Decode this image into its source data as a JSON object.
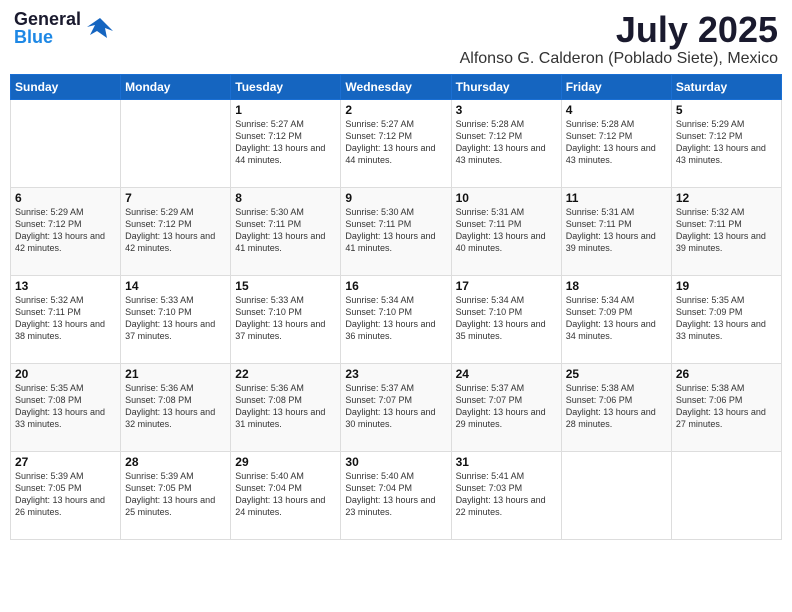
{
  "header": {
    "logo_general": "General",
    "logo_blue": "Blue",
    "main_title": "July 2025",
    "sub_title": "Alfonso G. Calderon (Poblado Siete), Mexico"
  },
  "weekdays": [
    "Sunday",
    "Monday",
    "Tuesday",
    "Wednesday",
    "Thursday",
    "Friday",
    "Saturday"
  ],
  "weeks": [
    [
      {
        "day": "",
        "info": ""
      },
      {
        "day": "",
        "info": ""
      },
      {
        "day": "1",
        "info": "Sunrise: 5:27 AM\nSunset: 7:12 PM\nDaylight: 13 hours and 44 minutes."
      },
      {
        "day": "2",
        "info": "Sunrise: 5:27 AM\nSunset: 7:12 PM\nDaylight: 13 hours and 44 minutes."
      },
      {
        "day": "3",
        "info": "Sunrise: 5:28 AM\nSunset: 7:12 PM\nDaylight: 13 hours and 43 minutes."
      },
      {
        "day": "4",
        "info": "Sunrise: 5:28 AM\nSunset: 7:12 PM\nDaylight: 13 hours and 43 minutes."
      },
      {
        "day": "5",
        "info": "Sunrise: 5:29 AM\nSunset: 7:12 PM\nDaylight: 13 hours and 43 minutes."
      }
    ],
    [
      {
        "day": "6",
        "info": "Sunrise: 5:29 AM\nSunset: 7:12 PM\nDaylight: 13 hours and 42 minutes."
      },
      {
        "day": "7",
        "info": "Sunrise: 5:29 AM\nSunset: 7:12 PM\nDaylight: 13 hours and 42 minutes."
      },
      {
        "day": "8",
        "info": "Sunrise: 5:30 AM\nSunset: 7:11 PM\nDaylight: 13 hours and 41 minutes."
      },
      {
        "day": "9",
        "info": "Sunrise: 5:30 AM\nSunset: 7:11 PM\nDaylight: 13 hours and 41 minutes."
      },
      {
        "day": "10",
        "info": "Sunrise: 5:31 AM\nSunset: 7:11 PM\nDaylight: 13 hours and 40 minutes."
      },
      {
        "day": "11",
        "info": "Sunrise: 5:31 AM\nSunset: 7:11 PM\nDaylight: 13 hours and 39 minutes."
      },
      {
        "day": "12",
        "info": "Sunrise: 5:32 AM\nSunset: 7:11 PM\nDaylight: 13 hours and 39 minutes."
      }
    ],
    [
      {
        "day": "13",
        "info": "Sunrise: 5:32 AM\nSunset: 7:11 PM\nDaylight: 13 hours and 38 minutes."
      },
      {
        "day": "14",
        "info": "Sunrise: 5:33 AM\nSunset: 7:10 PM\nDaylight: 13 hours and 37 minutes."
      },
      {
        "day": "15",
        "info": "Sunrise: 5:33 AM\nSunset: 7:10 PM\nDaylight: 13 hours and 37 minutes."
      },
      {
        "day": "16",
        "info": "Sunrise: 5:34 AM\nSunset: 7:10 PM\nDaylight: 13 hours and 36 minutes."
      },
      {
        "day": "17",
        "info": "Sunrise: 5:34 AM\nSunset: 7:10 PM\nDaylight: 13 hours and 35 minutes."
      },
      {
        "day": "18",
        "info": "Sunrise: 5:34 AM\nSunset: 7:09 PM\nDaylight: 13 hours and 34 minutes."
      },
      {
        "day": "19",
        "info": "Sunrise: 5:35 AM\nSunset: 7:09 PM\nDaylight: 13 hours and 33 minutes."
      }
    ],
    [
      {
        "day": "20",
        "info": "Sunrise: 5:35 AM\nSunset: 7:08 PM\nDaylight: 13 hours and 33 minutes."
      },
      {
        "day": "21",
        "info": "Sunrise: 5:36 AM\nSunset: 7:08 PM\nDaylight: 13 hours and 32 minutes."
      },
      {
        "day": "22",
        "info": "Sunrise: 5:36 AM\nSunset: 7:08 PM\nDaylight: 13 hours and 31 minutes."
      },
      {
        "day": "23",
        "info": "Sunrise: 5:37 AM\nSunset: 7:07 PM\nDaylight: 13 hours and 30 minutes."
      },
      {
        "day": "24",
        "info": "Sunrise: 5:37 AM\nSunset: 7:07 PM\nDaylight: 13 hours and 29 minutes."
      },
      {
        "day": "25",
        "info": "Sunrise: 5:38 AM\nSunset: 7:06 PM\nDaylight: 13 hours and 28 minutes."
      },
      {
        "day": "26",
        "info": "Sunrise: 5:38 AM\nSunset: 7:06 PM\nDaylight: 13 hours and 27 minutes."
      }
    ],
    [
      {
        "day": "27",
        "info": "Sunrise: 5:39 AM\nSunset: 7:05 PM\nDaylight: 13 hours and 26 minutes."
      },
      {
        "day": "28",
        "info": "Sunrise: 5:39 AM\nSunset: 7:05 PM\nDaylight: 13 hours and 25 minutes."
      },
      {
        "day": "29",
        "info": "Sunrise: 5:40 AM\nSunset: 7:04 PM\nDaylight: 13 hours and 24 minutes."
      },
      {
        "day": "30",
        "info": "Sunrise: 5:40 AM\nSunset: 7:04 PM\nDaylight: 13 hours and 23 minutes."
      },
      {
        "day": "31",
        "info": "Sunrise: 5:41 AM\nSunset: 7:03 PM\nDaylight: 13 hours and 22 minutes."
      },
      {
        "day": "",
        "info": ""
      },
      {
        "day": "",
        "info": ""
      }
    ]
  ]
}
